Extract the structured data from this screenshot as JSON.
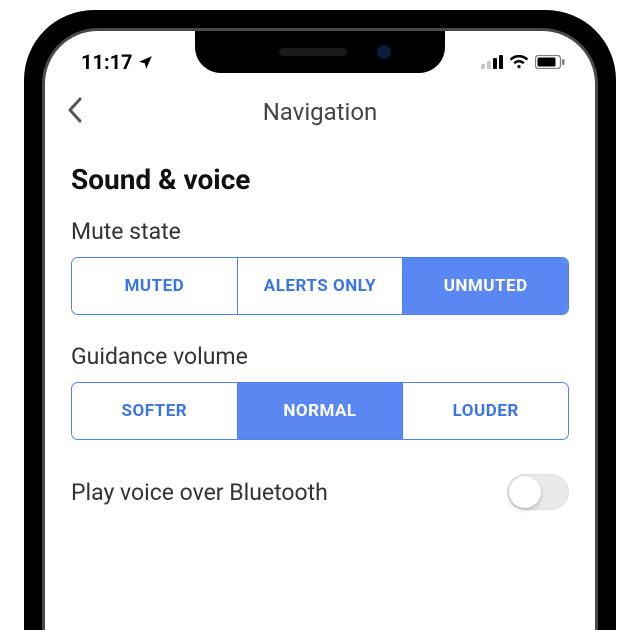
{
  "status": {
    "time": "11:17",
    "location_icon": "location-arrow",
    "signal_icon": "cellular",
    "wifi_icon": "wifi",
    "battery_icon": "battery"
  },
  "header": {
    "title": "Navigation",
    "back_icon": "chevron-left"
  },
  "section": {
    "title": "Sound & voice"
  },
  "mute_state": {
    "label": "Mute state",
    "options": [
      "MUTED",
      "ALERTS ONLY",
      "UNMUTED"
    ],
    "selected_index": 2
  },
  "guidance_volume": {
    "label": "Guidance volume",
    "options": [
      "SOFTER",
      "NORMAL",
      "LOUDER"
    ],
    "selected_index": 1
  },
  "bluetooth": {
    "label": "Play voice over Bluetooth",
    "enabled": false
  },
  "colors": {
    "accent": "#5a88f2",
    "accent_border": "#4f82f0"
  }
}
